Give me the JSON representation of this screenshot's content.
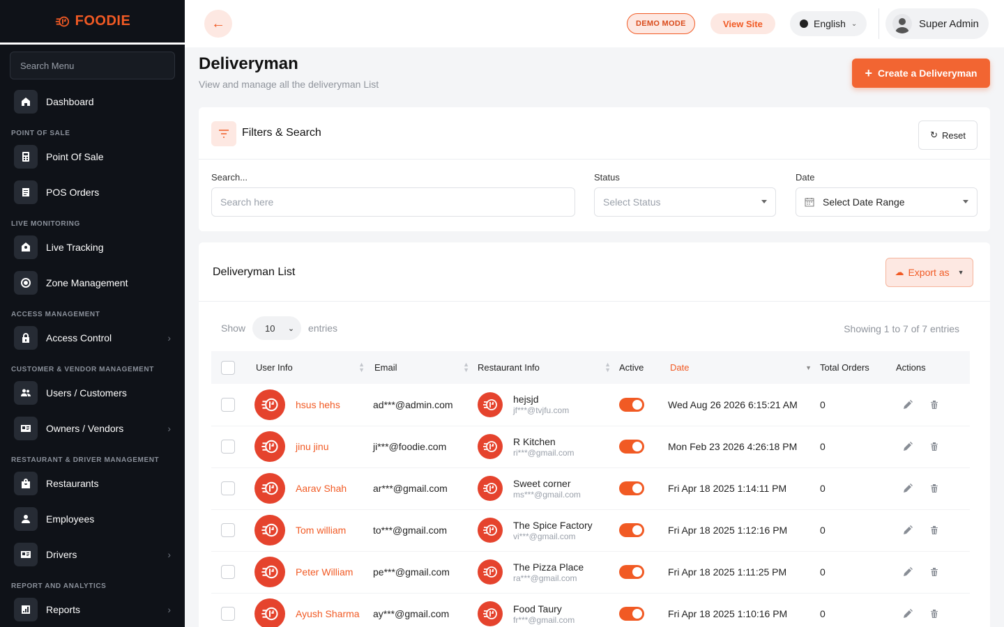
{
  "brand": {
    "name": "FOODIE",
    "color": "#f15a24"
  },
  "sidebar": {
    "search_placeholder": "Search Menu",
    "dashboard": "Dashboard",
    "sections": {
      "pos": "POINT OF SALE",
      "live": "LIVE MONITORING",
      "access": "ACCESS MANAGEMENT",
      "customer": "CUSTOMER & VENDOR MANAGEMENT",
      "restaurant": "RESTAURANT & DRIVER MANAGEMENT",
      "report": "REPORT AND ANALYTICS"
    },
    "items": {
      "point_of_sale": "Point Of Sale",
      "pos_orders": "POS Orders",
      "live_tracking": "Live Tracking",
      "zone_management": "Zone Management",
      "access_control": "Access Control",
      "users_customers": "Users / Customers",
      "owners_vendors": "Owners / Vendors",
      "restaurants": "Restaurants",
      "employees": "Employees",
      "drivers": "Drivers",
      "reports": "Reports"
    }
  },
  "header": {
    "demo_mode": "DEMO MODE",
    "view_site": "View Site",
    "language": "English",
    "user": "Super Admin"
  },
  "page": {
    "title": "Deliveryman",
    "subtitle": "View and manage all the deliveryman List",
    "create_button": "Create a Deliveryman"
  },
  "filters": {
    "title": "Filters & Search",
    "reset": "Reset",
    "search_label": "Search...",
    "search_placeholder": "Search here",
    "status_label": "Status",
    "status_placeholder": "Select Status",
    "date_label": "Date",
    "date_value": "Select Date Range"
  },
  "list": {
    "title": "Deliveryman List",
    "export": "Export as",
    "show": "Show",
    "entries_value": "10",
    "entries": "entries",
    "showing": "Showing 1 to 7 of 7 entries",
    "columns": {
      "user_info": "User Info",
      "email": "Email",
      "restaurant_info": "Restaurant Info",
      "active": "Active",
      "date": "Date",
      "total_orders": "Total Orders",
      "actions": "Actions"
    },
    "rows": [
      {
        "name": "hsus hehs",
        "email": "ad***@admin.com",
        "restaurant": "hejsjd",
        "restaurant_email": "jf***@tvjfu.com",
        "active": true,
        "date": "Wed Aug 26 2026 6:15:21 AM",
        "orders": "0"
      },
      {
        "name": "jinu jinu",
        "email": "ji***@foodie.com",
        "restaurant": "R Kitchen",
        "restaurant_email": "ri***@gmail.com",
        "active": true,
        "date": "Mon Feb 23 2026 4:26:18 PM",
        "orders": "0"
      },
      {
        "name": "Aarav Shah",
        "email": "ar***@gmail.com",
        "restaurant": "Sweet corner",
        "restaurant_email": "ms***@gmail.com",
        "active": true,
        "date": "Fri Apr 18 2025 1:14:11 PM",
        "orders": "0"
      },
      {
        "name": "Tom william",
        "email": "to***@gmail.com",
        "restaurant": "The Spice Factory",
        "restaurant_email": "vi***@gmail.com",
        "active": true,
        "date": "Fri Apr 18 2025 1:12:16 PM",
        "orders": "0"
      },
      {
        "name": "Peter William",
        "email": "pe***@gmail.com",
        "restaurant": "The Pizza Place",
        "restaurant_email": "ra***@gmail.com",
        "active": true,
        "date": "Fri Apr 18 2025 1:11:25 PM",
        "orders": "0"
      },
      {
        "name": "Ayush Sharma",
        "email": "ay***@gmail.com",
        "restaurant": "Food Taury",
        "restaurant_email": "fr***@gmail.com",
        "active": true,
        "date": "Fri Apr 18 2025 1:10:16 PM",
        "orders": "0"
      }
    ]
  }
}
